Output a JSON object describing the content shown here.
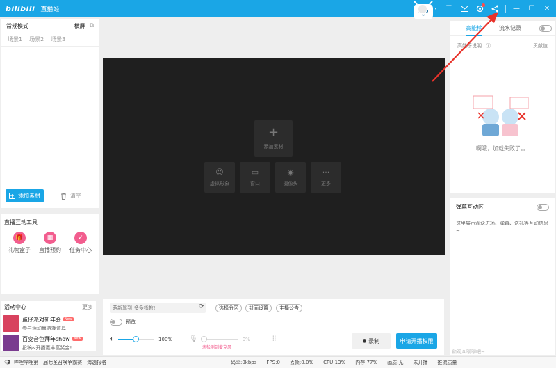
{
  "titlebar": {
    "logo": "bilibili",
    "app_name": "直播姬",
    "brand_color": "#1aa6e6"
  },
  "scene_panel": {
    "mode": "常规模式",
    "orientation": "横屏",
    "tabs": [
      "场景1",
      "场景2",
      "场景3"
    ],
    "add_source": "添加素材",
    "clear": "清空"
  },
  "tools": {
    "title": "直播互动工具",
    "items": [
      {
        "label": "礼物盒子",
        "icon": "gift-icon"
      },
      {
        "label": "直播预约",
        "icon": "calendar-icon"
      },
      {
        "label": "任务中心",
        "icon": "check-icon"
      }
    ]
  },
  "activity": {
    "title": "活动中心",
    "more": "更多",
    "items": [
      {
        "title": "蛋仔派对新年会",
        "tag": "New",
        "desc": "参与活动赢游戏道具!",
        "color": "#d8425e"
      },
      {
        "title": "百变音色拜年show",
        "tag": "New",
        "desc": "投稿&开播赢丰富奖金!",
        "color": "#7a3b8f"
      }
    ]
  },
  "stage": {
    "add_source": "添加素材",
    "sources": [
      {
        "label": "虚拟形象",
        "icon": "avatar-icon"
      },
      {
        "label": "窗口",
        "icon": "window-icon"
      },
      {
        "label": "摄像头",
        "icon": "camera-icon"
      },
      {
        "label": "更多",
        "icon": "more-icon"
      }
    ]
  },
  "controls": {
    "hint_placeholder": "萌新驾到!多多指教!",
    "chips": [
      "选择分区",
      "封面设置",
      "主播公告"
    ],
    "preview": "预览",
    "volume": "100%",
    "volume_level": 0.48,
    "mic_level": "0%",
    "mic_warning": "未检测到麦克风",
    "record": "录制",
    "apply_live": "申请开播权限"
  },
  "statusbar": {
    "ticker": "哔哩哔哩第一届七圣召唤争霸赛一海选报名",
    "stats": [
      "码率:0kbps",
      "FPS:0",
      "丢帧:0.0%",
      "CPU:13%",
      "内存:77%",
      "画质:无",
      "未开播",
      "推流质量"
    ]
  },
  "right_panel": {
    "tabs": [
      "高能榜",
      "流水记录"
    ],
    "rules": "高能榜说明",
    "contribution": "贡献值",
    "error_text": "啊哦，加载失败了。。",
    "danmaku_title": "弹幕互动区",
    "danmaku_desc": "这里展示观众进场、弹幕、送礼等互动信息~",
    "footer": "和观众聊聊吧~"
  },
  "annotation": {
    "arrow_color": "#e8322a"
  }
}
